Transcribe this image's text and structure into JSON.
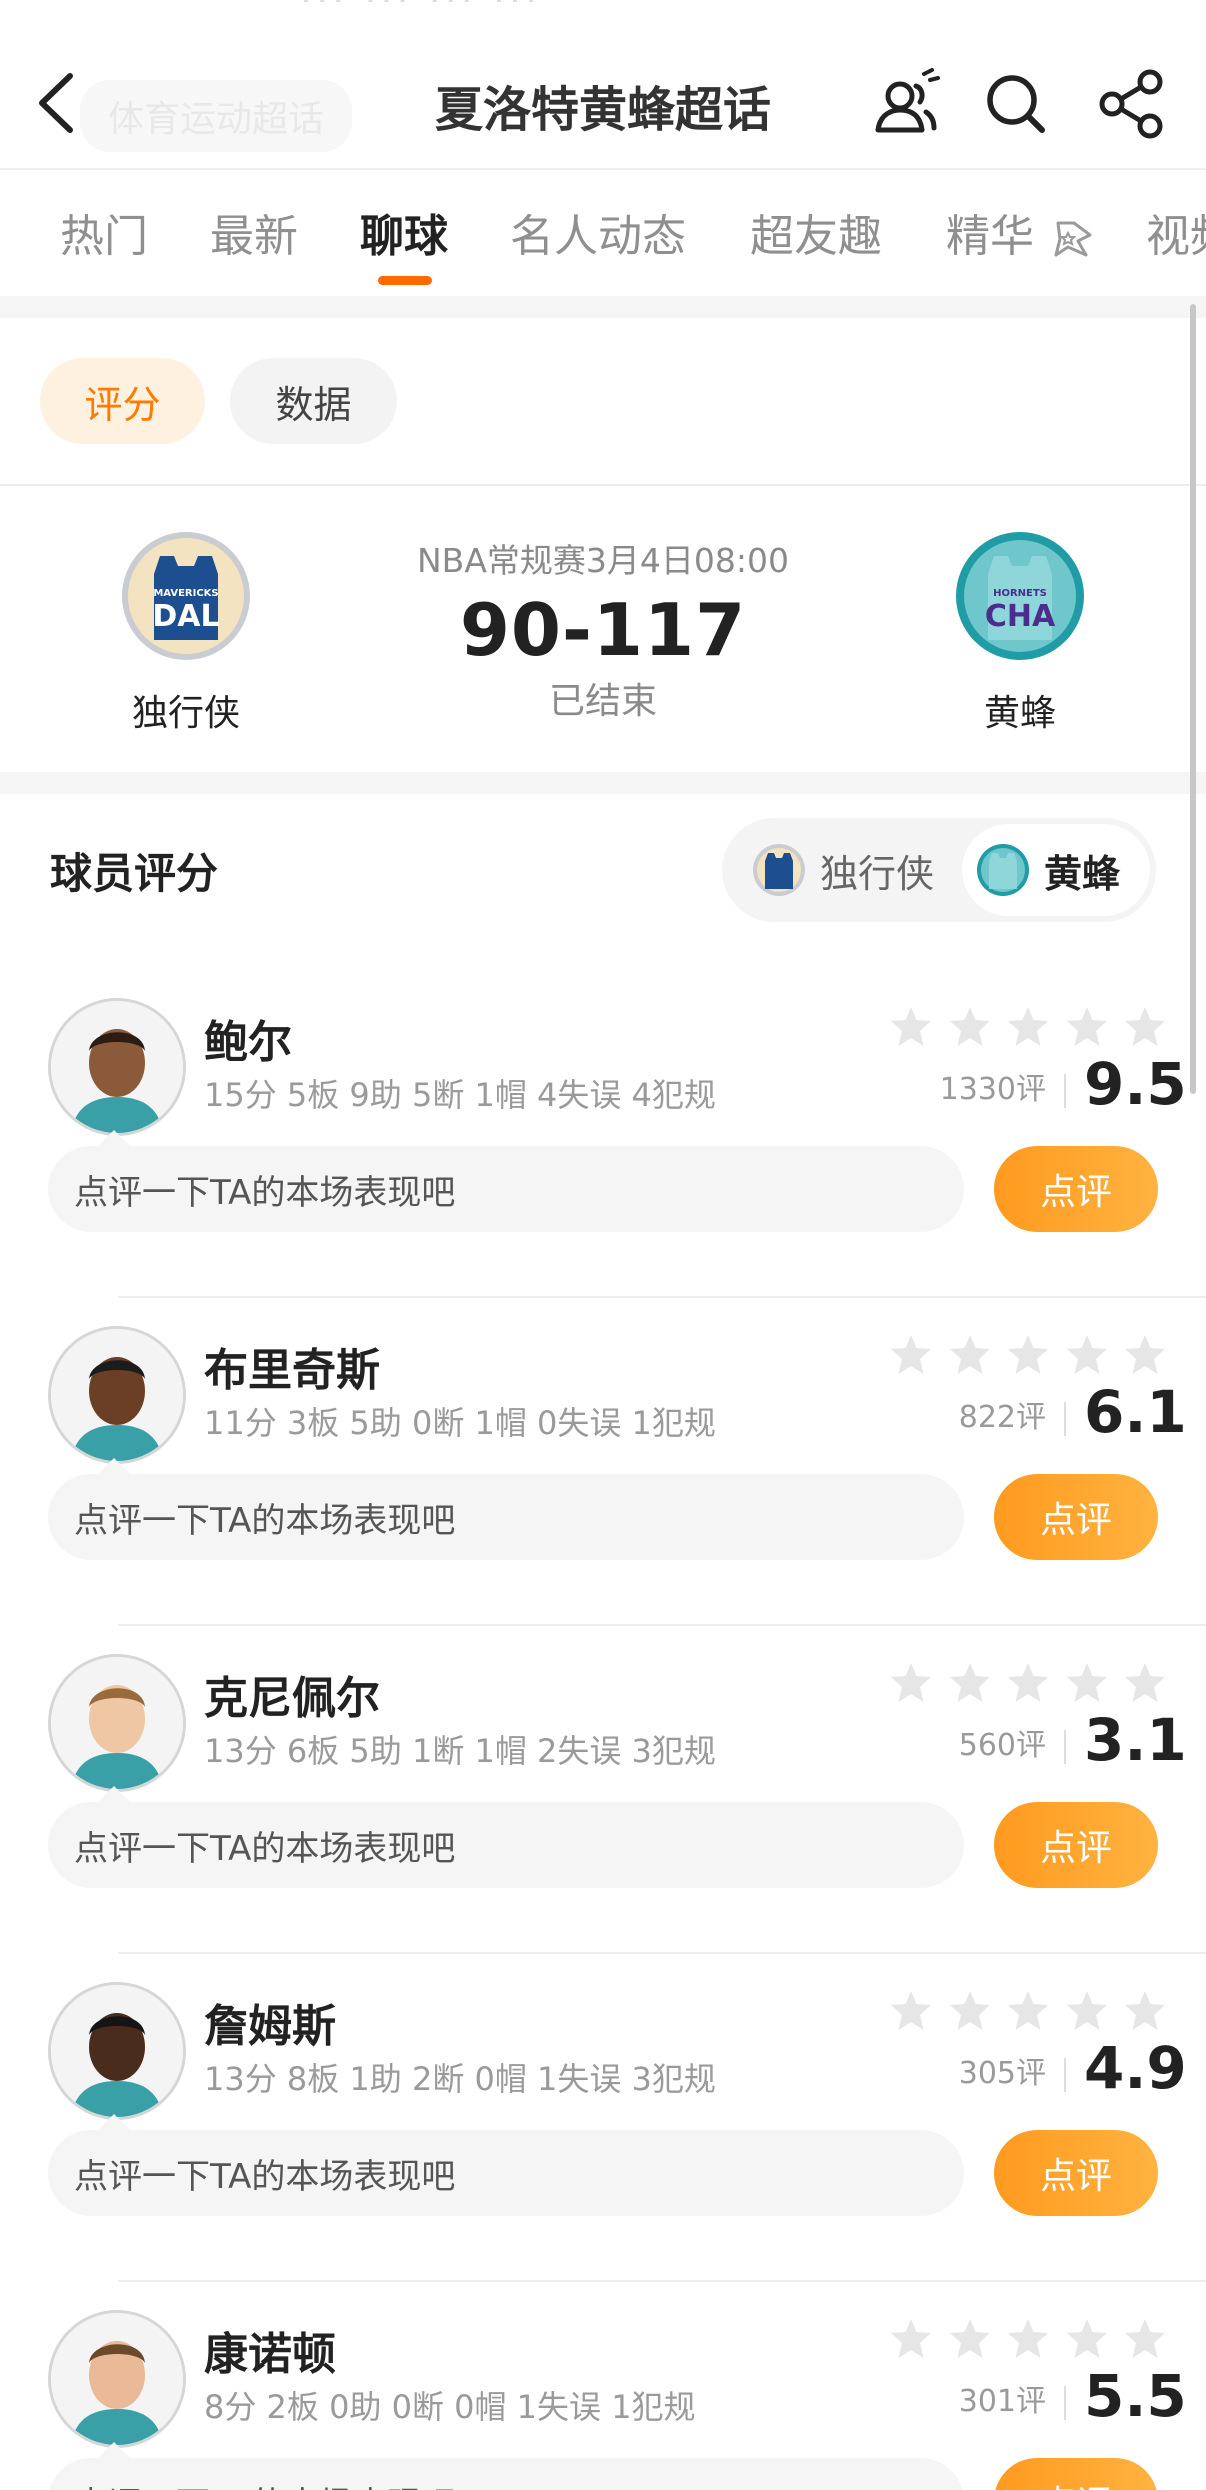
{
  "header": {
    "title": "夏洛特黄蜂超话",
    "ghost_tag": "体育运动超话",
    "back_icon": "chevron-left-icon",
    "icons": [
      "group-chat-icon",
      "search-icon",
      "share-icon"
    ]
  },
  "tabs": [
    {
      "label": "热门"
    },
    {
      "label": "最新"
    },
    {
      "label": "聊球"
    },
    {
      "label": "名人动态"
    },
    {
      "label": "超友趣"
    },
    {
      "label": "精华"
    },
    {
      "label": "视频"
    }
  ],
  "active_tab": "聊球",
  "filters": {
    "rating": "评分",
    "data": "数据",
    "active": "评分"
  },
  "match": {
    "meta": "NBA常规赛3月4日08:00",
    "score": "90-117",
    "status": "已结束",
    "home": {
      "name": "独行侠",
      "logo_text": "DAL",
      "logo_sub": "MAVERICKS",
      "color": "#1d4e8f"
    },
    "away": {
      "name": "黄蜂",
      "logo_text": "CHA",
      "logo_sub": "HORNETS",
      "color": "#4a2e8c"
    }
  },
  "section": {
    "title": "球员评分",
    "team_left": "独行侠",
    "team_right": "黄蜂",
    "selected": "黄蜂"
  },
  "players": [
    {
      "name": "鲍尔",
      "stats": "15分 5板 9助 5断 1帽 4失误 4犯规",
      "count": "1330评",
      "score": "9.5",
      "placeholder": "点评一下TA的本场表现吧",
      "button": "点评"
    },
    {
      "name": "布里奇斯",
      "stats": "11分 3板 5助 0断 1帽 0失误 1犯规",
      "count": "822评",
      "score": "6.1",
      "placeholder": "点评一下TA的本场表现吧",
      "button": "点评"
    },
    {
      "name": "克尼佩尔",
      "stats": "13分 6板 5助 1断 1帽 2失误 3犯规",
      "count": "560评",
      "score": "3.1",
      "placeholder": "点评一下TA的本场表现吧",
      "button": "点评"
    },
    {
      "name": "詹姆斯",
      "stats": "13分 8板 1助 2断 0帽 1失误 3犯规",
      "count": "305评",
      "score": "4.9",
      "placeholder": "点评一下TA的本场表现吧",
      "button": "点评"
    },
    {
      "name": "康诺顿",
      "stats": "8分 2板 0助 0断 0帽 1失误 1犯规",
      "count": "301评",
      "score": "5.5",
      "placeholder": "点评一下TA的本场表现吧",
      "button": "点评"
    }
  ],
  "colors": {
    "accent": "#ff7a00",
    "button": "#ffa52a",
    "star_empty": "#e6e6e6"
  }
}
